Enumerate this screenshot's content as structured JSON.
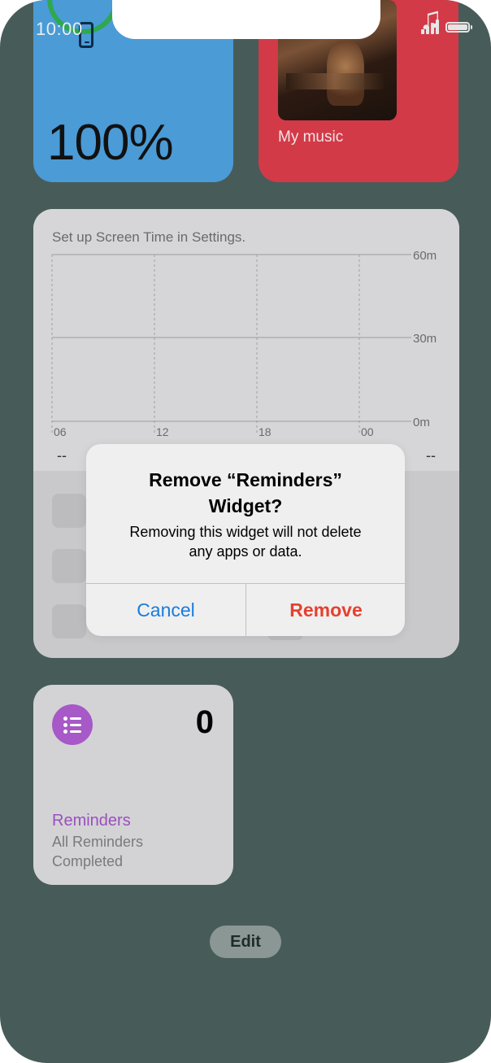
{
  "status_bar": {
    "time": "10:00"
  },
  "battery_widget": {
    "percent": "100%",
    "level": 1.0,
    "ring_color": "#2fa84f",
    "background": "#4a9bd6"
  },
  "music_widget": {
    "label": "My music",
    "background": "#d23a48"
  },
  "screen_time_widget": {
    "message": "Set up Screen Time in Settings.",
    "y_labels": [
      "60m",
      "30m",
      "0m"
    ],
    "x_labels": [
      "06",
      "12",
      "18",
      "00"
    ],
    "left_value": "--",
    "right_value": "--"
  },
  "reminders_widget": {
    "count": "0",
    "name": "Reminders",
    "subtitle_line1": "All Reminders",
    "subtitle_line2": "Completed",
    "accent": "#a659c7"
  },
  "edit_button": {
    "label": "Edit"
  },
  "alert": {
    "title_line1": "Remove “Reminders”",
    "title_line2": "Widget?",
    "message_line1": "Removing this widget will not delete",
    "message_line2": "any apps or data.",
    "cancel_label": "Cancel",
    "remove_label": "Remove",
    "cancel_color": "#1a7bdc",
    "remove_color": "#e5402f"
  },
  "icons": [
    "phone-icon",
    "music-note-icon",
    "signal-icon",
    "battery-icon",
    "list-icon"
  ]
}
